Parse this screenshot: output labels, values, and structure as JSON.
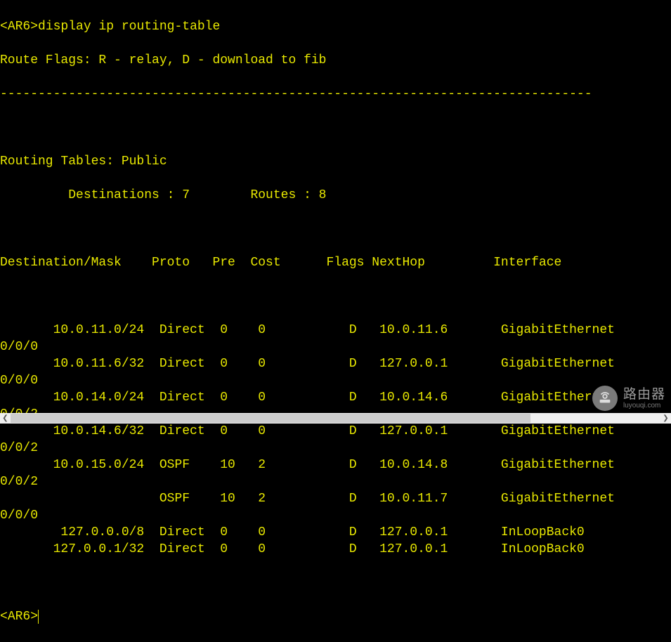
{
  "prompt": {
    "open": "<",
    "host": "AR6",
    "close": ">"
  },
  "command": "display ip routing-table",
  "header_lines": {
    "flags": "Route Flags: R - relay, D - download to fib",
    "sep": "------------------------------------------------------------------------------",
    "tables": "Routing Tables: Public",
    "dest_routes": "         Destinations : 7        Routes : 8"
  },
  "columns": "Destination/Mask    Proto   Pre  Cost      Flags NextHop         Interface",
  "routes": [
    {
      "dest": "       10.0.11.0/24",
      "proto": "Direct",
      "pre": "0",
      "cost": "0",
      "flags": "D",
      "nexthop": "10.0.11.6",
      "iface": "GigabitEthernet",
      "wrap": "0/0/0"
    },
    {
      "dest": "       10.0.11.6/32",
      "proto": "Direct",
      "pre": "0",
      "cost": "0",
      "flags": "D",
      "nexthop": "127.0.0.1",
      "iface": "GigabitEthernet",
      "wrap": "0/0/0"
    },
    {
      "dest": "       10.0.14.0/24",
      "proto": "Direct",
      "pre": "0",
      "cost": "0",
      "flags": "D",
      "nexthop": "10.0.14.6",
      "iface": "GigabitEthernet",
      "wrap": "0/0/2"
    },
    {
      "dest": "       10.0.14.6/32",
      "proto": "Direct",
      "pre": "0",
      "cost": "0",
      "flags": "D",
      "nexthop": "127.0.0.1",
      "iface": "GigabitEthernet",
      "wrap": "0/0/2"
    },
    {
      "dest": "       10.0.15.0/24",
      "proto": "OSPF  ",
      "pre": "10",
      "cost": "2",
      "flags": "D",
      "nexthop": "10.0.14.8",
      "iface": "GigabitEthernet",
      "wrap": "0/0/2"
    },
    {
      "dest": "                   ",
      "proto": "OSPF  ",
      "pre": "10",
      "cost": "2",
      "flags": "D",
      "nexthop": "10.0.11.7",
      "iface": "GigabitEthernet",
      "wrap": "0/0/0"
    },
    {
      "dest": "        127.0.0.0/8",
      "proto": "Direct",
      "pre": "0",
      "cost": "0",
      "flags": "D",
      "nexthop": "127.0.0.1",
      "iface": "InLoopBack0",
      "wrap": ""
    },
    {
      "dest": "       127.0.0.1/32",
      "proto": "Direct",
      "pre": "0",
      "cost": "0",
      "flags": "D",
      "nexthop": "127.0.0.1",
      "iface": "InLoopBack0",
      "wrap": ""
    }
  ],
  "watermark": {
    "line1": "路由器",
    "line2": "luyouqi.com"
  },
  "scroll_arrows": {
    "left": "❮",
    "right": "❯"
  }
}
